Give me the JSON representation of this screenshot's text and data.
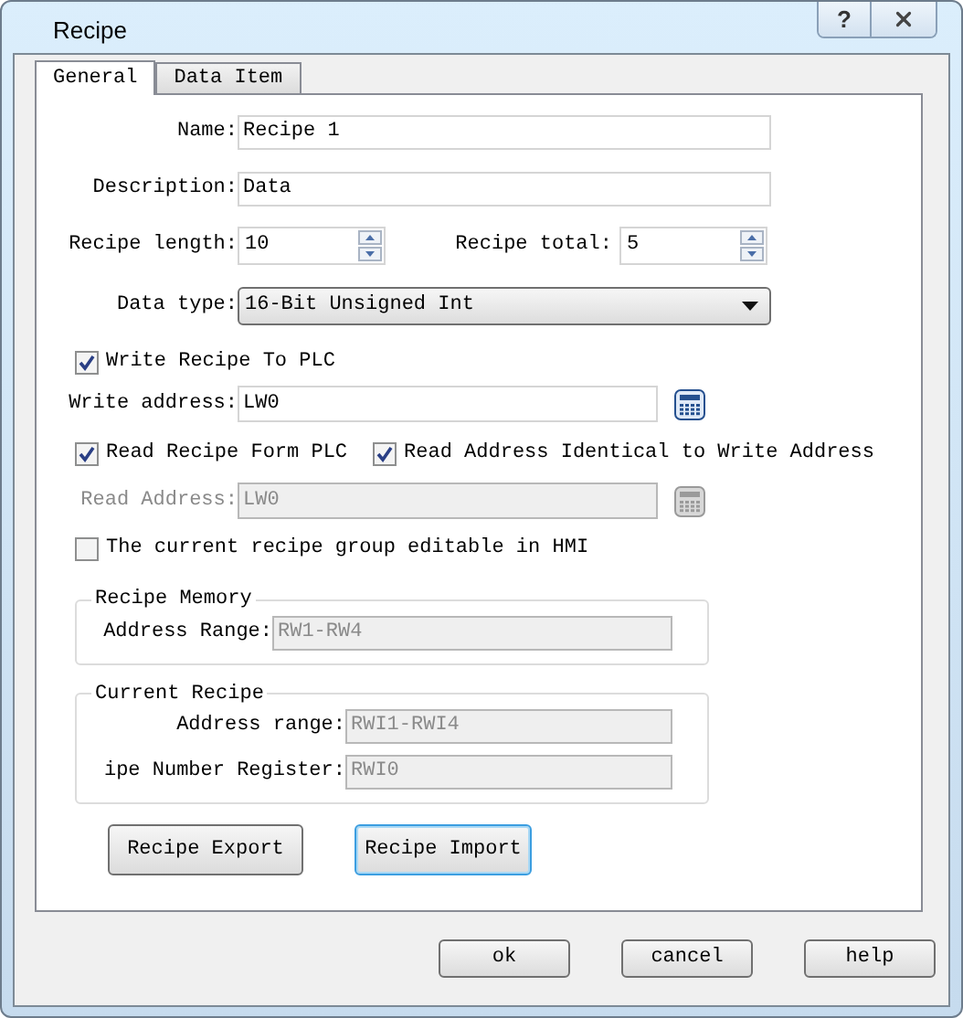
{
  "window": {
    "title": "Recipe",
    "help_button": "?"
  },
  "tabs": [
    {
      "label": "General",
      "selected": true
    },
    {
      "label": "Data Item",
      "selected": false
    }
  ],
  "name": {
    "label": "Name:",
    "value": "Recipe 1"
  },
  "description": {
    "label": "Description:",
    "value": "Data"
  },
  "recipe_length": {
    "label": "Recipe length:",
    "value": "10"
  },
  "recipe_total": {
    "label": "Recipe total:",
    "value": "5"
  },
  "data_type": {
    "label": "Data type:",
    "value": "16-Bit Unsigned Int"
  },
  "write_to_plc": {
    "label": "Write Recipe To PLC",
    "checked": true
  },
  "write_address": {
    "label": "Write address:",
    "value": "LW0",
    "disabled": false
  },
  "read_from_plc": {
    "label": "Read Recipe Form PLC",
    "checked": true
  },
  "read_identical": {
    "label": "Read Address Identical to Write Address",
    "checked": true
  },
  "read_address": {
    "label": "Read Address:",
    "value": "LW0",
    "disabled": true
  },
  "editable_in_hmi": {
    "label": "The current recipe group editable in HMI",
    "checked": false
  },
  "recipe_memory": {
    "title": "Recipe Memory",
    "fields": [
      {
        "label": "Address Range:",
        "value": "RW1-RW4",
        "disabled": true
      }
    ]
  },
  "current_recipe": {
    "title": "Current Recipe",
    "fields": [
      {
        "label": "Address range:",
        "value": "RWI1-RWI4",
        "disabled": true
      },
      {
        "label": "ipe Number Register:",
        "value": "RWI0",
        "disabled": true
      }
    ]
  },
  "panel_buttons": [
    {
      "label": "Recipe Export",
      "focused": false
    },
    {
      "label": "Recipe Import",
      "focused": true
    }
  ],
  "dialog_buttons": [
    "ok",
    "cancel",
    "help"
  ]
}
